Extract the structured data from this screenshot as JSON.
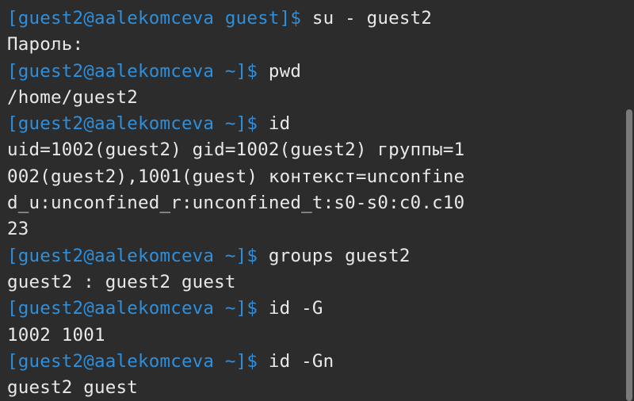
{
  "terminal": {
    "lines": [
      {
        "prompt": "[guest2@aalekomceva guest]$ ",
        "command": "su - guest2"
      },
      {
        "output": "Пароль:"
      },
      {
        "prompt": "[guest2@aalekomceva ~]$ ",
        "command": "pwd"
      },
      {
        "output": "/home/guest2"
      },
      {
        "prompt": "[guest2@aalekomceva ~]$ ",
        "command": "id"
      },
      {
        "output": "uid=1002(guest2) gid=1002(guest2) группы=1"
      },
      {
        "output": "002(guest2),1001(guest) контекст=unconfine"
      },
      {
        "output": "d_u:unconfined_r:unconfined_t:s0-s0:c0.c10"
      },
      {
        "output": "23"
      },
      {
        "prompt": "[guest2@aalekomceva ~]$ ",
        "command": "groups guest2"
      },
      {
        "output": "guest2 : guest2 guest"
      },
      {
        "prompt": "[guest2@aalekomceva ~]$ ",
        "command": "id -G"
      },
      {
        "output": "1002 1001"
      },
      {
        "prompt": "[guest2@aalekomceva ~]$ ",
        "command": "id -Gn"
      },
      {
        "output": "guest2 guest"
      }
    ]
  },
  "colors": {
    "background": "#2c2c2c",
    "prompt": "#2e8fdc",
    "text": "#e9e9e9",
    "scrollbar": "#7a7a7a"
  }
}
